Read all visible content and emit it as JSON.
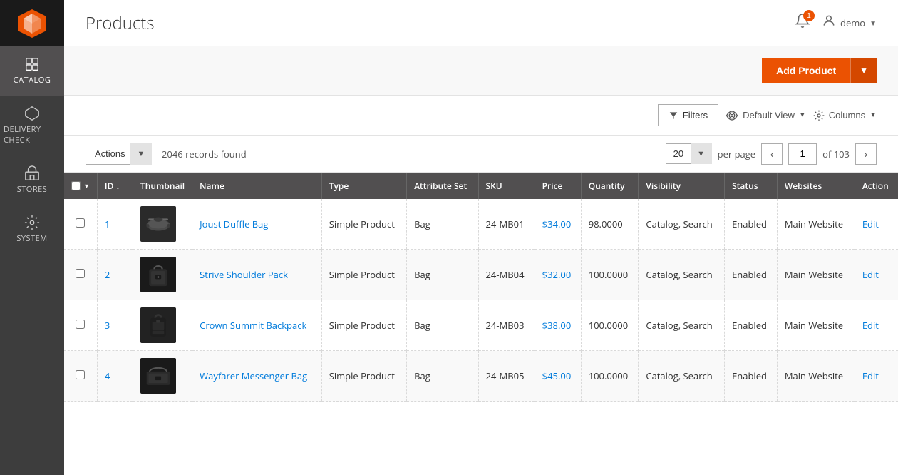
{
  "sidebar": {
    "logo_alt": "Magento Logo",
    "items": [
      {
        "id": "catalog",
        "label": "CATALOG",
        "icon": "📦",
        "active": true
      },
      {
        "id": "delivery",
        "label": "DELIVERY CHECK",
        "icon": "⬡",
        "active": false
      },
      {
        "id": "stores",
        "label": "STORES",
        "icon": "🏪",
        "active": false
      },
      {
        "id": "system",
        "label": "SYSTEM",
        "icon": "⚙",
        "active": false
      }
    ]
  },
  "header": {
    "page_title": "Products",
    "notification_count": "1",
    "user_name": "demo"
  },
  "toolbar": {
    "add_product_label": "Add Product",
    "filters_label": "Filters",
    "default_view_label": "Default View",
    "columns_label": "Columns"
  },
  "records_bar": {
    "actions_label": "Actions",
    "records_found": "2046 records found",
    "per_page_value": "20",
    "per_page_label": "per page",
    "current_page": "1",
    "total_pages": "103"
  },
  "table": {
    "columns": [
      {
        "id": "checkbox",
        "label": ""
      },
      {
        "id": "id",
        "label": "ID ↓"
      },
      {
        "id": "thumbnail",
        "label": "Thumbnail"
      },
      {
        "id": "name",
        "label": "Name"
      },
      {
        "id": "type",
        "label": "Type"
      },
      {
        "id": "attribute_set",
        "label": "Attribute Set"
      },
      {
        "id": "sku",
        "label": "SKU"
      },
      {
        "id": "price",
        "label": "Price"
      },
      {
        "id": "quantity",
        "label": "Quantity"
      },
      {
        "id": "visibility",
        "label": "Visibility"
      },
      {
        "id": "status",
        "label": "Status"
      },
      {
        "id": "websites",
        "label": "Websites"
      },
      {
        "id": "action",
        "label": "Action"
      }
    ],
    "rows": [
      {
        "id": "1",
        "name": "Joust Duffle Bag",
        "type": "Simple Product",
        "attribute_set": "Bag",
        "sku": "24-MB01",
        "price": "$34.00",
        "quantity": "98.0000",
        "visibility": "Catalog, Search",
        "status": "Enabled",
        "websites": "Main Website",
        "action": "Edit",
        "thumb_color": "#2a2a2a",
        "thumb_shape": "duffle"
      },
      {
        "id": "2",
        "name": "Strive Shoulder Pack",
        "type": "Simple Product",
        "attribute_set": "Bag",
        "sku": "24-MB04",
        "price": "$32.00",
        "quantity": "100.0000",
        "visibility": "Catalog, Search",
        "status": "Enabled",
        "websites": "Main Website",
        "action": "Edit",
        "thumb_color": "#1a1a1a",
        "thumb_shape": "shoulder"
      },
      {
        "id": "3",
        "name": "Crown Summit Backpack",
        "type": "Simple Product",
        "attribute_set": "Bag",
        "sku": "24-MB03",
        "price": "$38.00",
        "quantity": "100.0000",
        "visibility": "Catalog, Search",
        "status": "Enabled",
        "websites": "Main Website",
        "action": "Edit",
        "thumb_color": "#222",
        "thumb_shape": "backpack"
      },
      {
        "id": "4",
        "name": "Wayfarer Messenger Bag",
        "type": "Simple Product",
        "attribute_set": "Bag",
        "sku": "24-MB05",
        "price": "$45.00",
        "quantity": "100.0000",
        "visibility": "Catalog, Search",
        "status": "Enabled",
        "websites": "Main Website",
        "action": "Edit",
        "thumb_color": "#1a1a1a",
        "thumb_shape": "messenger"
      }
    ]
  }
}
